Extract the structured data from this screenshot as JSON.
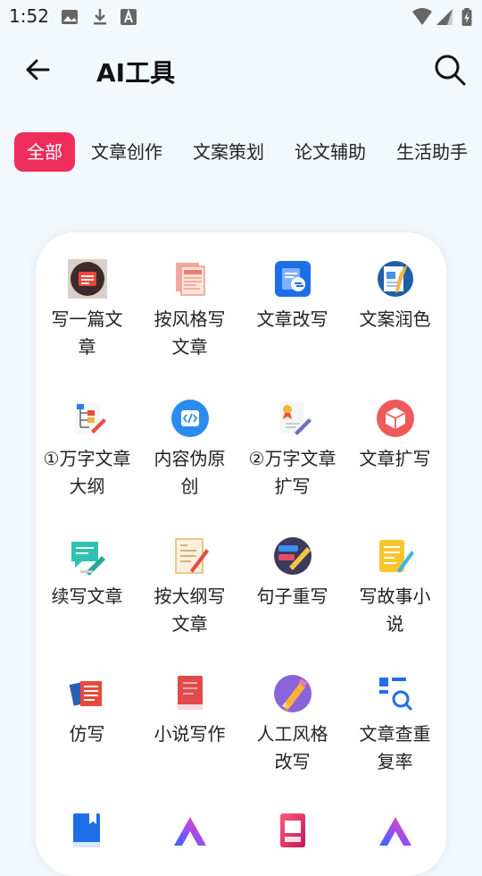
{
  "status_bar": {
    "time": "1:52"
  },
  "header": {
    "title": "AI工具"
  },
  "tabs": [
    {
      "label": "全部",
      "active": true
    },
    {
      "label": "文章创作"
    },
    {
      "label": "文案策划"
    },
    {
      "label": "论文辅助"
    },
    {
      "label": "生活助手"
    }
  ],
  "tools": [
    {
      "label": "写一篇文章",
      "icon": "dark-doc-icon"
    },
    {
      "label": "按风格写文章",
      "icon": "news-stack-icon"
    },
    {
      "label": "文章改写",
      "icon": "blue-refresh-doc-icon"
    },
    {
      "label": "文案润色",
      "icon": "doc-quill-icon"
    },
    {
      "label": "①万字文章大纲",
      "icon": "outline-tree-icon"
    },
    {
      "label": "内容伪原创",
      "icon": "code-circle-icon"
    },
    {
      "label": "②万字文章扩写",
      "icon": "certificate-pen-icon"
    },
    {
      "label": "文章扩写",
      "icon": "red-box-icon"
    },
    {
      "label": "续写文章",
      "icon": "chat-pen-icon"
    },
    {
      "label": "按大纲写文章",
      "icon": "paper-pencil-icon"
    },
    {
      "label": "句子重写",
      "icon": "sentence-pencil-icon"
    },
    {
      "label": "写故事小说",
      "icon": "yellow-notes-pen-icon"
    },
    {
      "label": "仿写",
      "icon": "notebook-stack-icon"
    },
    {
      "label": "小说写作",
      "icon": "red-book-icon"
    },
    {
      "label": "人工风格改写",
      "icon": "purple-pencil-icon"
    },
    {
      "label": "文章查重复率",
      "icon": "doc-search-icon"
    },
    {
      "label": "",
      "icon": "blue-book-icon"
    },
    {
      "label": "",
      "icon": "gradient-a-logo-icon"
    },
    {
      "label": "",
      "icon": "ppt-file-icon"
    },
    {
      "label": "",
      "icon": "gradient-a-logo-icon"
    }
  ]
}
